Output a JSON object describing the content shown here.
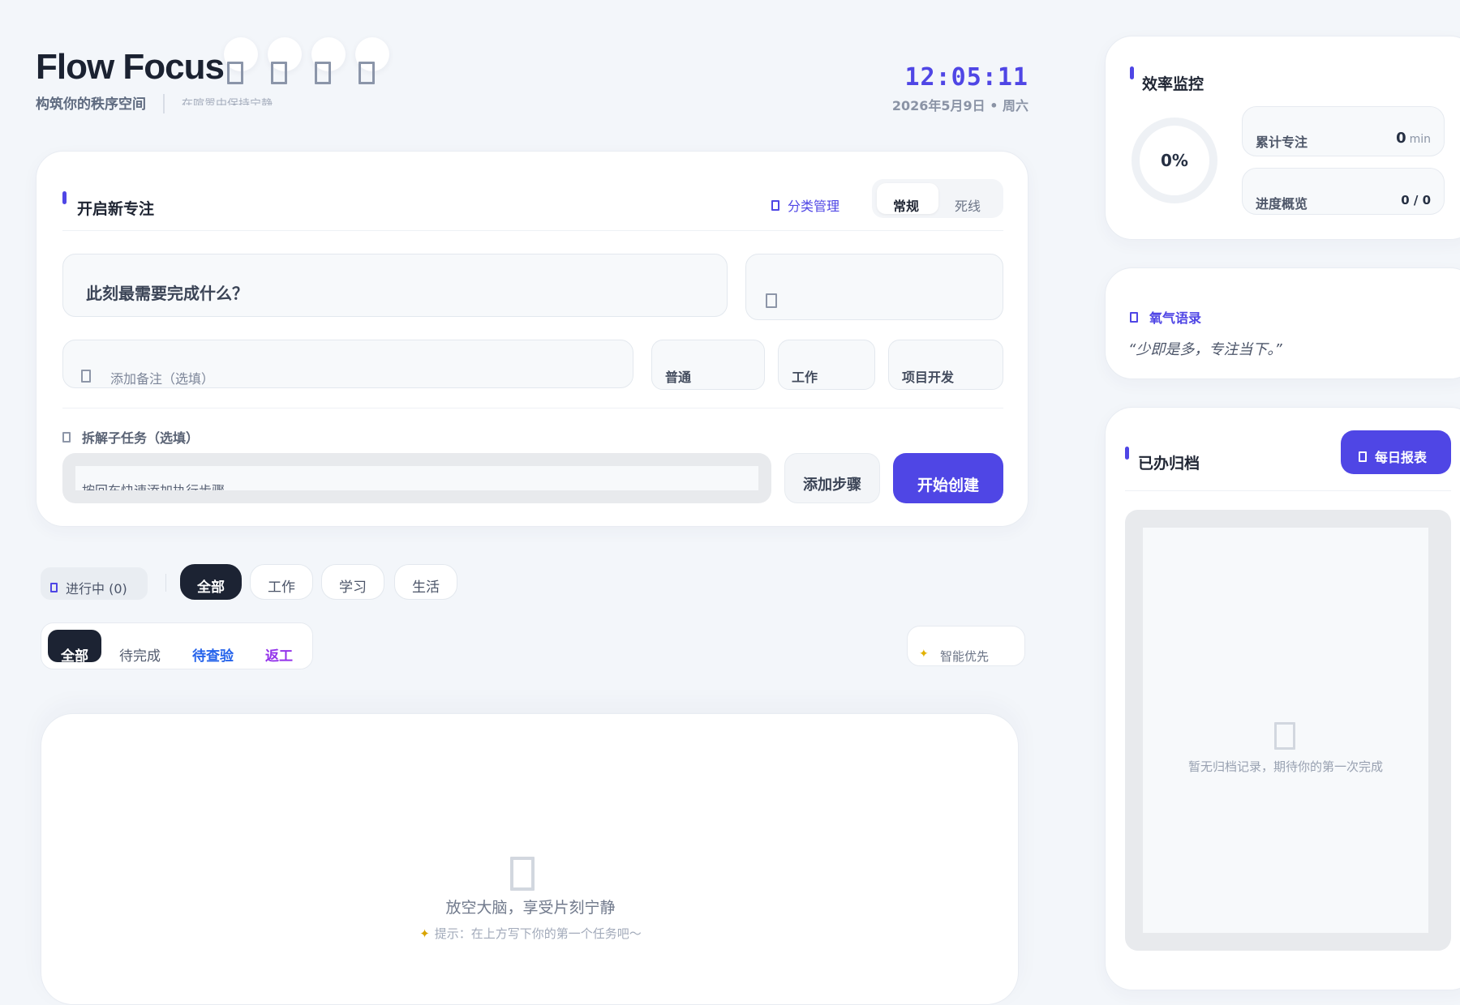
{
  "header": {
    "app_title": "Flow Focus",
    "subtitle": "构筑你的秩序空间",
    "subtitle_rotating": "在喧嚣中保持宁静",
    "clock": "12:05:11",
    "date": "2026年5月9日 • 周六"
  },
  "new_focus": {
    "heading": "开启新专注",
    "category_manage": "分类管理",
    "mode_tabs": [
      "常规",
      "死线"
    ],
    "task_placeholder": "此刻最需要完成什么？",
    "note_placeholder": "添加备注（选填）",
    "priority_chips": [
      "普通",
      "工作",
      "项目开发"
    ],
    "subtasks_label": "拆解子任务（选填）",
    "subtask_placeholder": "按回车快速添加执行步骤",
    "add_step_button": "添加步骤",
    "create_button": "开始创建"
  },
  "filters": {
    "in_progress_label": "进行中 (0)",
    "categories": [
      "全部",
      "工作",
      "学习",
      "生活"
    ],
    "status_tabs": [
      {
        "label": "全部",
        "color": "#ffffff"
      },
      {
        "label": "待完成",
        "color": "#525b6e"
      },
      {
        "label": "待查验",
        "color": "#2563eb"
      },
      {
        "label": "返工",
        "color": "#9333ea"
      }
    ],
    "smart_priority": "智能优先"
  },
  "task_list": {
    "empty_title": "放空大脑，享受片刻宁静",
    "empty_hint": "提示：在上方写下你的第一个任务吧～"
  },
  "efficiency": {
    "heading": "效率监控",
    "ring_percent": "0%",
    "total_focus_label": "累计专注",
    "total_focus_value": "0",
    "total_focus_unit": "min",
    "progress_label": "进度概览",
    "progress_value": "0 / 0"
  },
  "quote": {
    "heading": "氧气语录",
    "text": "“少即是多，专注当下。”"
  },
  "archive": {
    "heading": "已办归档",
    "daily_report_button": "每日报表",
    "empty_text": "暂无归档记录，期待你的第一次完成"
  },
  "colors": {
    "accent": "#4f46e5",
    "dark": "#1c2333",
    "background": "#f3f6fa"
  },
  "icons": [
    "note-icon",
    "tag-icon",
    "subtask-icon",
    "folder-icon",
    "quote-icon",
    "report-icon",
    "sparkle-icon",
    "inbox-icon"
  ]
}
